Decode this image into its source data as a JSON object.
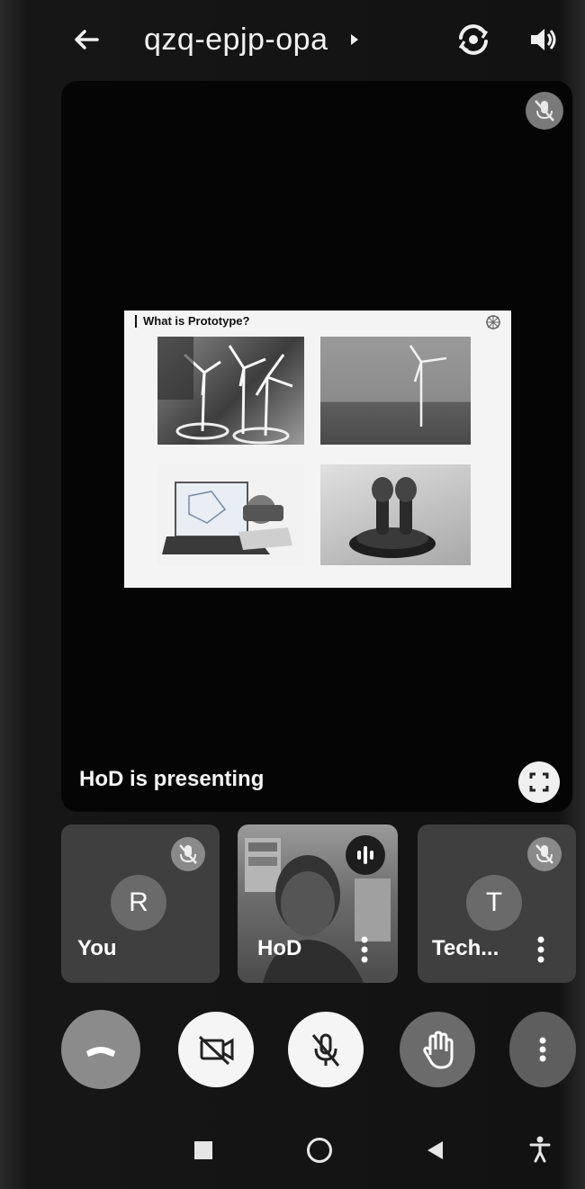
{
  "header": {
    "meeting_code": "qzq-epjp-opa",
    "back_icon": "arrow-left-icon",
    "switch_camera_icon": "switch-camera-icon",
    "audio_output_icon": "speaker-icon"
  },
  "presentation": {
    "slide_title": "What is Prototype?",
    "images": [
      "wind-turbine-models-photo",
      "offshore-wind-turbine-photo",
      "laptop-cad-prototype-photo",
      "3d-printed-object-photo"
    ],
    "presenting_text": "HoD is presenting",
    "fullscreen_icon": "fullscreen-icon"
  },
  "participants": [
    {
      "name": "You",
      "initial": "R",
      "muted": true
    },
    {
      "name": "HoD",
      "initial": "",
      "muted": false,
      "speaking": true
    },
    {
      "name": "Tech...",
      "initial": "T",
      "muted": true
    }
  ],
  "controls": [
    "end-call",
    "camera-off",
    "mic-off",
    "raise-hand",
    "more-options"
  ],
  "nav": [
    "recents",
    "home",
    "back",
    "accessibility"
  ]
}
